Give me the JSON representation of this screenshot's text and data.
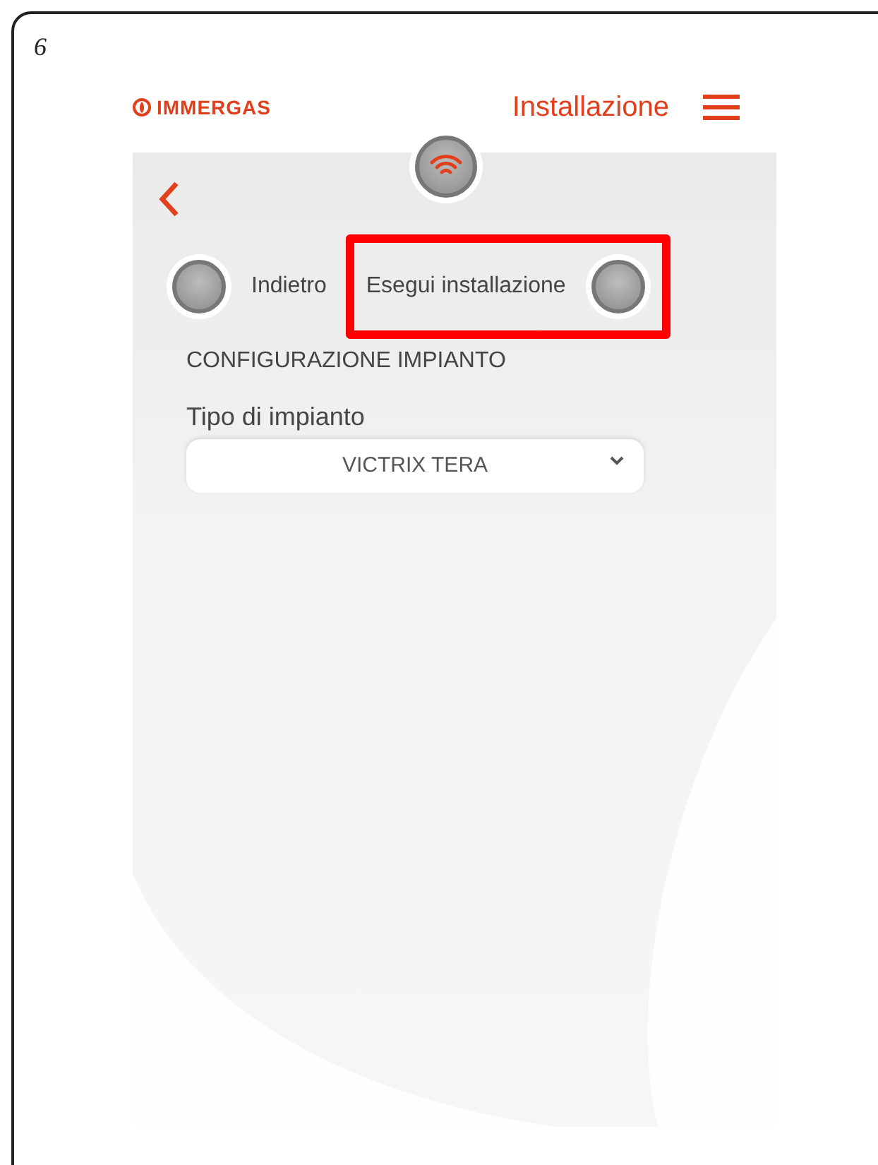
{
  "page_number": "6",
  "header": {
    "logo": "IMMERGAS",
    "title": "Installazione"
  },
  "actions": [
    {
      "kind": "left",
      "label": "Indietro",
      "highlighted": false
    },
    {
      "kind": "right",
      "label": "Esegui installazione",
      "highlighted": true
    }
  ],
  "section_title": "CONFIGURAZIONE IMPIANTO",
  "field": {
    "label": "Tipo di impianto",
    "value": "VICTRIX TERA"
  }
}
